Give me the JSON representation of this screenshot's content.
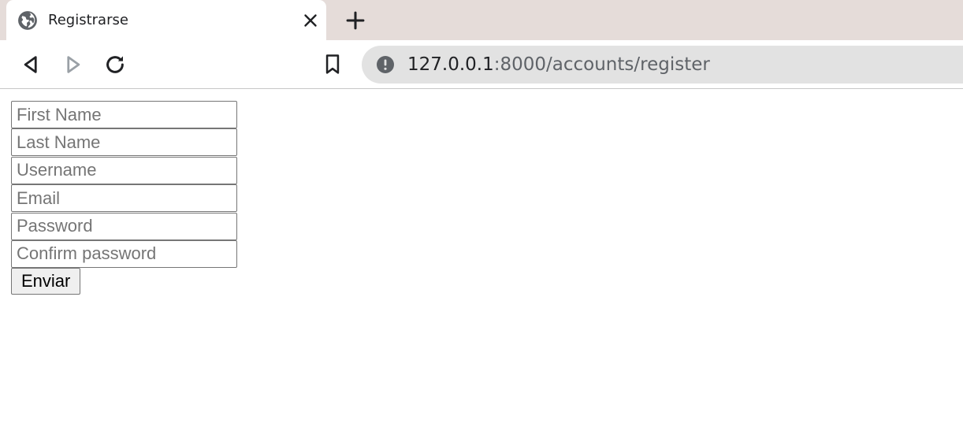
{
  "browser": {
    "tab": {
      "title": "Registrarse",
      "favicon": "globe-icon"
    },
    "address_bar": {
      "host": "127.0.0.1",
      "rest": ":8000/accounts/register"
    },
    "icons": {
      "back": "back-arrow-icon",
      "forward": "forward-arrow-icon",
      "reload": "reload-icon",
      "bookmark": "bookmark-icon",
      "info": "info-icon",
      "close": "close-icon",
      "new_tab": "plus-icon"
    }
  },
  "form": {
    "fields": [
      {
        "name": "first_name",
        "placeholder": "First Name",
        "value": ""
      },
      {
        "name": "last_name",
        "placeholder": "Last Name",
        "value": ""
      },
      {
        "name": "username",
        "placeholder": "Username",
        "value": ""
      },
      {
        "name": "email",
        "placeholder": "Email",
        "value": ""
      },
      {
        "name": "password",
        "placeholder": "Password",
        "value": ""
      },
      {
        "name": "confirm_password",
        "placeholder": "Confirm password",
        "value": ""
      }
    ],
    "submit_label": "Enviar"
  },
  "colors": {
    "tabbar_bg": "#e5dcd9",
    "omnibox_bg": "#e2e2e2",
    "icon_dark": "#202124",
    "icon_disabled": "#9aa0a6"
  }
}
